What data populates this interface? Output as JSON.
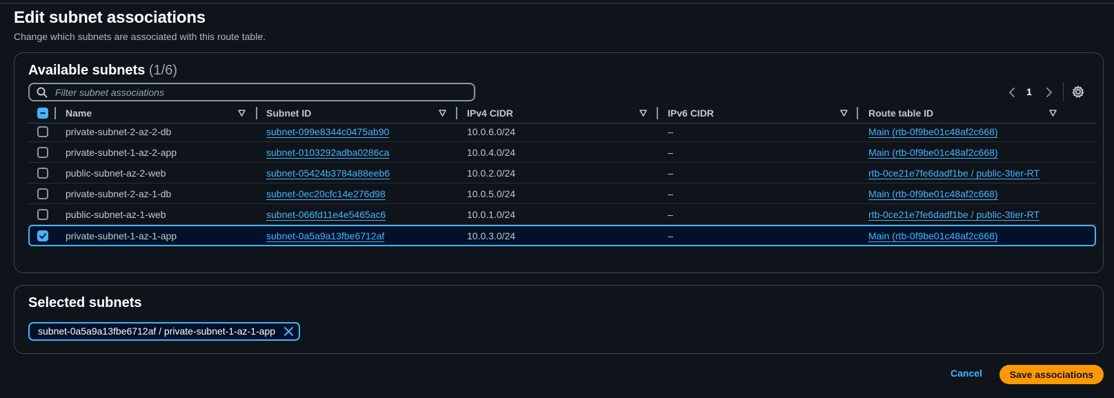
{
  "header": {
    "title": "Edit subnet associations",
    "description": "Change which subnets are associated with this route table."
  },
  "available": {
    "title": "Available subnets",
    "count": "(1/6)",
    "search_placeholder": "Filter subnet associations",
    "page_number": "1",
    "columns": [
      "Name",
      "Subnet ID",
      "IPv4 CIDR",
      "IPv6 CIDR",
      "Route table ID"
    ],
    "rows": [
      {
        "name": "private-subnet-2-az-2-db",
        "subnet_id": "subnet-099e8344c0475ab90",
        "ipv4": "10.0.6.0/24",
        "ipv6": "–",
        "route_table": "Main (rtb-0f9be01c48af2c668)",
        "checked": false
      },
      {
        "name": "private-subnet-1-az-2-app",
        "subnet_id": "subnet-0103292adba0286ca",
        "ipv4": "10.0.4.0/24",
        "ipv6": "–",
        "route_table": "Main (rtb-0f9be01c48af2c668)",
        "checked": false
      },
      {
        "name": "public-subnet-az-2-web",
        "subnet_id": "subnet-05424b3784a88eeb6",
        "ipv4": "10.0.2.0/24",
        "ipv6": "–",
        "route_table": "rtb-0ce21e7fe6dadf1be / public-3tier-RT",
        "checked": false
      },
      {
        "name": "private-subnet-2-az-1-db",
        "subnet_id": "subnet-0ec20cfc14e276d98",
        "ipv4": "10.0.5.0/24",
        "ipv6": "–",
        "route_table": "Main (rtb-0f9be01c48af2c668)",
        "checked": false
      },
      {
        "name": "public-subnet-az-1-web",
        "subnet_id": "subnet-066fd11e4e5465ac6",
        "ipv4": "10.0.1.0/24",
        "ipv6": "–",
        "route_table": "rtb-0ce21e7fe6dadf1be / public-3tier-RT",
        "checked": false
      },
      {
        "name": "private-subnet-1-az-1-app",
        "subnet_id": "subnet-0a5a9a13fbe6712af",
        "ipv4": "10.0.3.0/24",
        "ipv6": "–",
        "route_table": "Main (rtb-0f9be01c48af2c668)",
        "checked": true
      }
    ]
  },
  "selected": {
    "title": "Selected subnets",
    "chip_label": "subnet-0a5a9a13fbe6712af / private-subnet-1-az-1-app"
  },
  "footer": {
    "cancel_label": "Cancel",
    "save_label": "Save associations"
  },
  "colors": {
    "background": "#0f141a",
    "link": "#42b4ff",
    "primary_button": "#ff9900",
    "border": "#3d4552"
  },
  "icons": {
    "search": "search-icon",
    "prev": "chevron-left-icon",
    "next": "chevron-right-icon",
    "settings": "gear-icon",
    "sort": "sort-caret-icon",
    "remove": "close-icon"
  }
}
